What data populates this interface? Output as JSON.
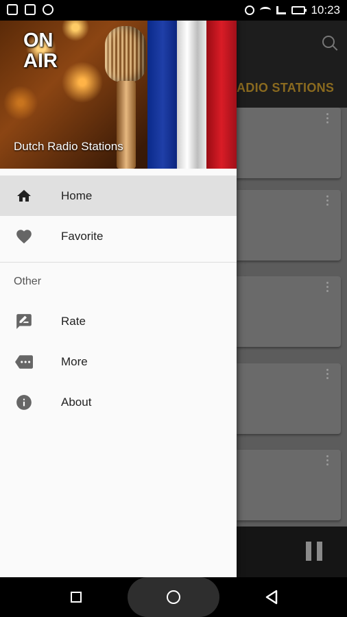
{
  "status_bar": {
    "time": "10:23"
  },
  "app": {
    "toolbar_title": "DUTCH RADIO STATIONS",
    "visible_title": "ADIO STATIONS"
  },
  "drawer": {
    "header": {
      "badge": "ON\nAIR",
      "title": "Dutch Radio Stations"
    },
    "items": [
      {
        "label": "Home",
        "icon": "home-icon",
        "active": true
      },
      {
        "label": "Favorite",
        "icon": "heart-icon",
        "active": false
      }
    ],
    "section_label": "Other",
    "other_items": [
      {
        "label": "Rate",
        "icon": "rate-review-icon"
      },
      {
        "label": "More",
        "icon": "more-tag-icon"
      },
      {
        "label": "About",
        "icon": "info-icon"
      }
    ]
  },
  "colors": {
    "accent_title": "#8a6a1f",
    "drawer_bg": "#fafafa",
    "active_bg": "#e0e0e0"
  }
}
